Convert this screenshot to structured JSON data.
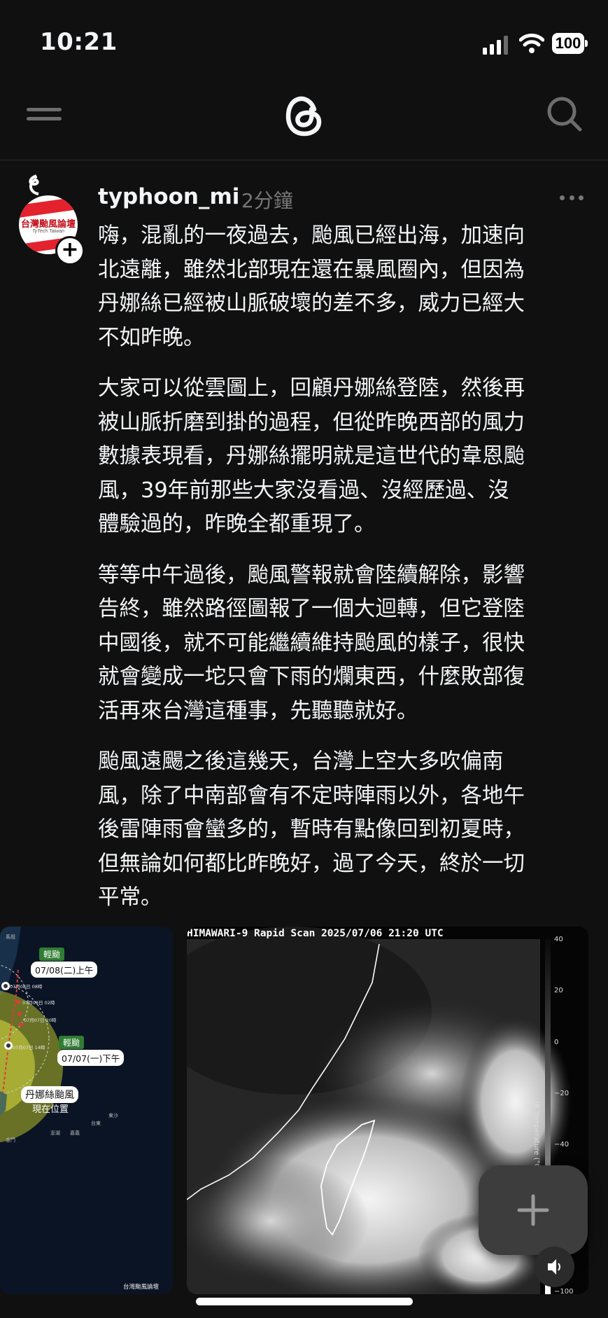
{
  "status_bar": {
    "time": "10:21",
    "battery": "100"
  },
  "nav": {
    "menu_icon": "menu-icon",
    "logo_icon": "threads-logo-icon",
    "search_icon": "search-icon"
  },
  "post": {
    "username": "typhoon_mi",
    "timestamp": "2分鐘",
    "avatar_text": "台灣颱風論壇",
    "avatar_subtext": "TyTech Taiwan",
    "paragraphs": [
      [
        "嗨，混亂的一夜過去，颱風已經出海，加速向",
        "北遠離，雖然北部現在還在暴風圈內，但因為",
        "丹娜絲已經被山脈破壞的差不多，威力已經大",
        "不如昨晚。"
      ],
      [
        "大家可以從雲圖上，回顧丹娜絲登陸，然後再",
        "被山脈折磨到掛的過程，但從昨晚西部的風力",
        "數據表現看，丹娜絲擺明就是這世代的韋恩颱",
        "風，39年前那些大家沒看過、沒經歷過、沒",
        "體驗過的，昨晚全都重現了。"
      ],
      [
        "等等中午過後，颱風警報就會陸續解除，影響",
        "告終，雖然路徑圖報了一個大迴轉，但它登陸",
        "中國後，就不可能繼續維持颱風的樣子，很快",
        "就會變成一坨只會下雨的爛東西，什麼敗部復",
        "活再來台灣這種事，先聽聽就好。"
      ],
      [
        "颱風遠颺之後這幾天，台灣上空大多吹偏南",
        "風，除了中南部會有不定時陣雨以外，各地午",
        "後雷陣雨會蠻多的，暫時有點像回到初夏時，",
        "但無論如何都比昨晚好，過了今天，終於一切",
        "平常。"
      ]
    ],
    "track_map": {
      "badge1": "輕颱",
      "label1": "07/08(二)上午",
      "badge2": "輕颱",
      "label2": "07/07(一)下午",
      "storm_name": "丹娜絲颱風",
      "current_pos": "現在位置",
      "credit": "台灣颱風論壇",
      "small_labels": [
        "07月08日 08時",
        "07月08日 02時",
        "07月07日 20時",
        "07月07日 14時",
        "金門",
        "馬祖",
        "東沙",
        "澎湖",
        "嘉義",
        "台東"
      ]
    },
    "satellite": {
      "title": "HIMAWARI-9 Rapid Scan 2025/07/06 21:20 UTC",
      "scale_ticks": [
        "40",
        "20",
        "0",
        "−20",
        "−40",
        "−100"
      ],
      "scale_label": "IR Temperature (°C)"
    }
  },
  "fab": {
    "icon": "plus-icon"
  },
  "volume": {
    "icon": "speaker-icon"
  }
}
